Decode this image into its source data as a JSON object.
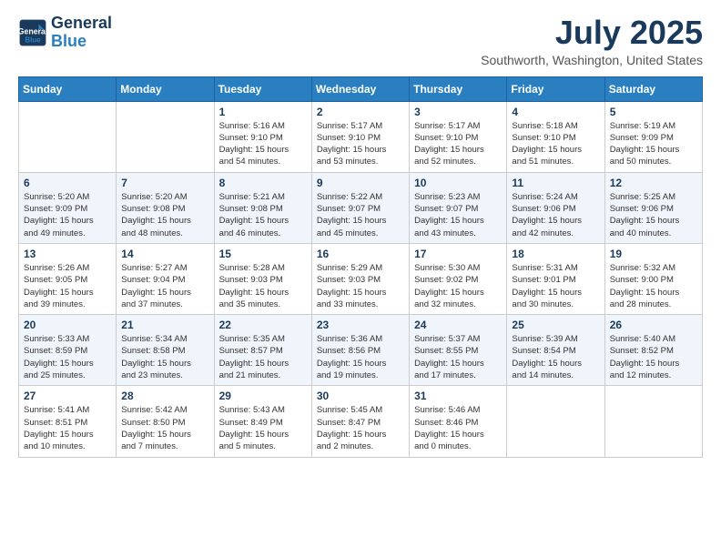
{
  "header": {
    "logo_line1": "General",
    "logo_line2": "Blue",
    "month_title": "July 2025",
    "location": "Southworth, Washington, United States"
  },
  "calendar": {
    "days_of_week": [
      "Sunday",
      "Monday",
      "Tuesday",
      "Wednesday",
      "Thursday",
      "Friday",
      "Saturday"
    ],
    "weeks": [
      [
        {
          "num": "",
          "info": ""
        },
        {
          "num": "",
          "info": ""
        },
        {
          "num": "1",
          "info": "Sunrise: 5:16 AM\nSunset: 9:10 PM\nDaylight: 15 hours\nand 54 minutes."
        },
        {
          "num": "2",
          "info": "Sunrise: 5:17 AM\nSunset: 9:10 PM\nDaylight: 15 hours\nand 53 minutes."
        },
        {
          "num": "3",
          "info": "Sunrise: 5:17 AM\nSunset: 9:10 PM\nDaylight: 15 hours\nand 52 minutes."
        },
        {
          "num": "4",
          "info": "Sunrise: 5:18 AM\nSunset: 9:10 PM\nDaylight: 15 hours\nand 51 minutes."
        },
        {
          "num": "5",
          "info": "Sunrise: 5:19 AM\nSunset: 9:09 PM\nDaylight: 15 hours\nand 50 minutes."
        }
      ],
      [
        {
          "num": "6",
          "info": "Sunrise: 5:20 AM\nSunset: 9:09 PM\nDaylight: 15 hours\nand 49 minutes."
        },
        {
          "num": "7",
          "info": "Sunrise: 5:20 AM\nSunset: 9:08 PM\nDaylight: 15 hours\nand 48 minutes."
        },
        {
          "num": "8",
          "info": "Sunrise: 5:21 AM\nSunset: 9:08 PM\nDaylight: 15 hours\nand 46 minutes."
        },
        {
          "num": "9",
          "info": "Sunrise: 5:22 AM\nSunset: 9:07 PM\nDaylight: 15 hours\nand 45 minutes."
        },
        {
          "num": "10",
          "info": "Sunrise: 5:23 AM\nSunset: 9:07 PM\nDaylight: 15 hours\nand 43 minutes."
        },
        {
          "num": "11",
          "info": "Sunrise: 5:24 AM\nSunset: 9:06 PM\nDaylight: 15 hours\nand 42 minutes."
        },
        {
          "num": "12",
          "info": "Sunrise: 5:25 AM\nSunset: 9:06 PM\nDaylight: 15 hours\nand 40 minutes."
        }
      ],
      [
        {
          "num": "13",
          "info": "Sunrise: 5:26 AM\nSunset: 9:05 PM\nDaylight: 15 hours\nand 39 minutes."
        },
        {
          "num": "14",
          "info": "Sunrise: 5:27 AM\nSunset: 9:04 PM\nDaylight: 15 hours\nand 37 minutes."
        },
        {
          "num": "15",
          "info": "Sunrise: 5:28 AM\nSunset: 9:03 PM\nDaylight: 15 hours\nand 35 minutes."
        },
        {
          "num": "16",
          "info": "Sunrise: 5:29 AM\nSunset: 9:03 PM\nDaylight: 15 hours\nand 33 minutes."
        },
        {
          "num": "17",
          "info": "Sunrise: 5:30 AM\nSunset: 9:02 PM\nDaylight: 15 hours\nand 32 minutes."
        },
        {
          "num": "18",
          "info": "Sunrise: 5:31 AM\nSunset: 9:01 PM\nDaylight: 15 hours\nand 30 minutes."
        },
        {
          "num": "19",
          "info": "Sunrise: 5:32 AM\nSunset: 9:00 PM\nDaylight: 15 hours\nand 28 minutes."
        }
      ],
      [
        {
          "num": "20",
          "info": "Sunrise: 5:33 AM\nSunset: 8:59 PM\nDaylight: 15 hours\nand 25 minutes."
        },
        {
          "num": "21",
          "info": "Sunrise: 5:34 AM\nSunset: 8:58 PM\nDaylight: 15 hours\nand 23 minutes."
        },
        {
          "num": "22",
          "info": "Sunrise: 5:35 AM\nSunset: 8:57 PM\nDaylight: 15 hours\nand 21 minutes."
        },
        {
          "num": "23",
          "info": "Sunrise: 5:36 AM\nSunset: 8:56 PM\nDaylight: 15 hours\nand 19 minutes."
        },
        {
          "num": "24",
          "info": "Sunrise: 5:37 AM\nSunset: 8:55 PM\nDaylight: 15 hours\nand 17 minutes."
        },
        {
          "num": "25",
          "info": "Sunrise: 5:39 AM\nSunset: 8:54 PM\nDaylight: 15 hours\nand 14 minutes."
        },
        {
          "num": "26",
          "info": "Sunrise: 5:40 AM\nSunset: 8:52 PM\nDaylight: 15 hours\nand 12 minutes."
        }
      ],
      [
        {
          "num": "27",
          "info": "Sunrise: 5:41 AM\nSunset: 8:51 PM\nDaylight: 15 hours\nand 10 minutes."
        },
        {
          "num": "28",
          "info": "Sunrise: 5:42 AM\nSunset: 8:50 PM\nDaylight: 15 hours\nand 7 minutes."
        },
        {
          "num": "29",
          "info": "Sunrise: 5:43 AM\nSunset: 8:49 PM\nDaylight: 15 hours\nand 5 minutes."
        },
        {
          "num": "30",
          "info": "Sunrise: 5:45 AM\nSunset: 8:47 PM\nDaylight: 15 hours\nand 2 minutes."
        },
        {
          "num": "31",
          "info": "Sunrise: 5:46 AM\nSunset: 8:46 PM\nDaylight: 15 hours\nand 0 minutes."
        },
        {
          "num": "",
          "info": ""
        },
        {
          "num": "",
          "info": ""
        }
      ]
    ]
  }
}
